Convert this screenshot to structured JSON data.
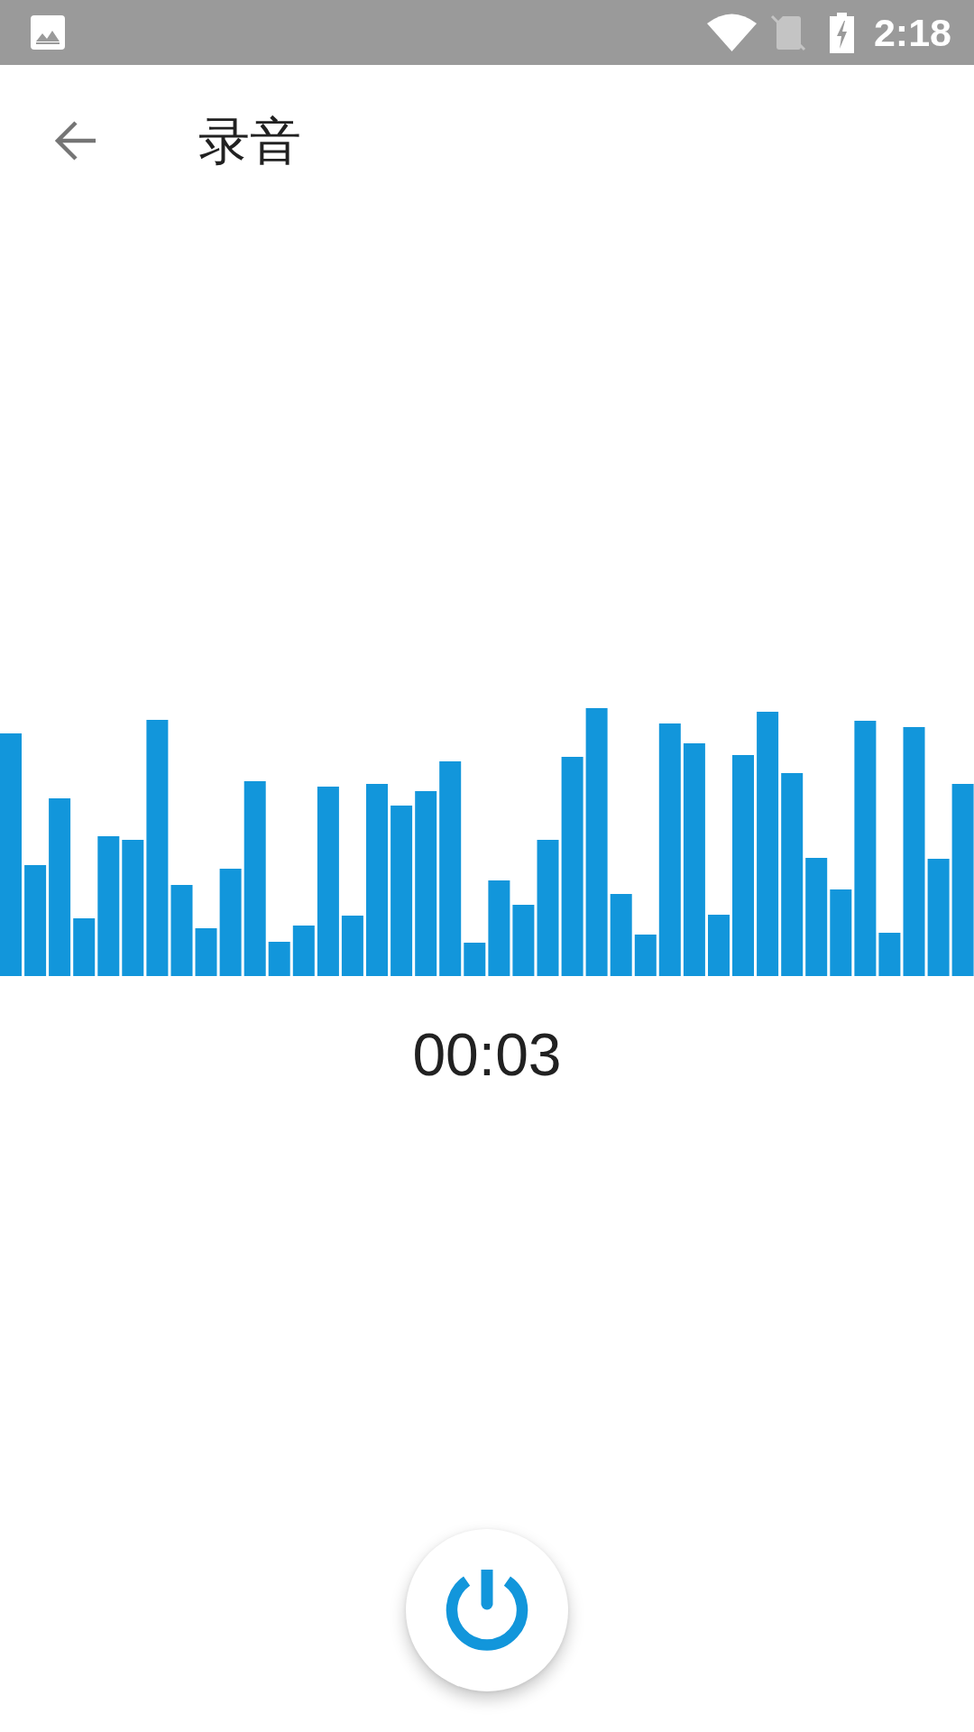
{
  "status_bar": {
    "time": "2:18"
  },
  "toolbar": {
    "title": "录音"
  },
  "recorder": {
    "elapsed": "00:03"
  }
}
